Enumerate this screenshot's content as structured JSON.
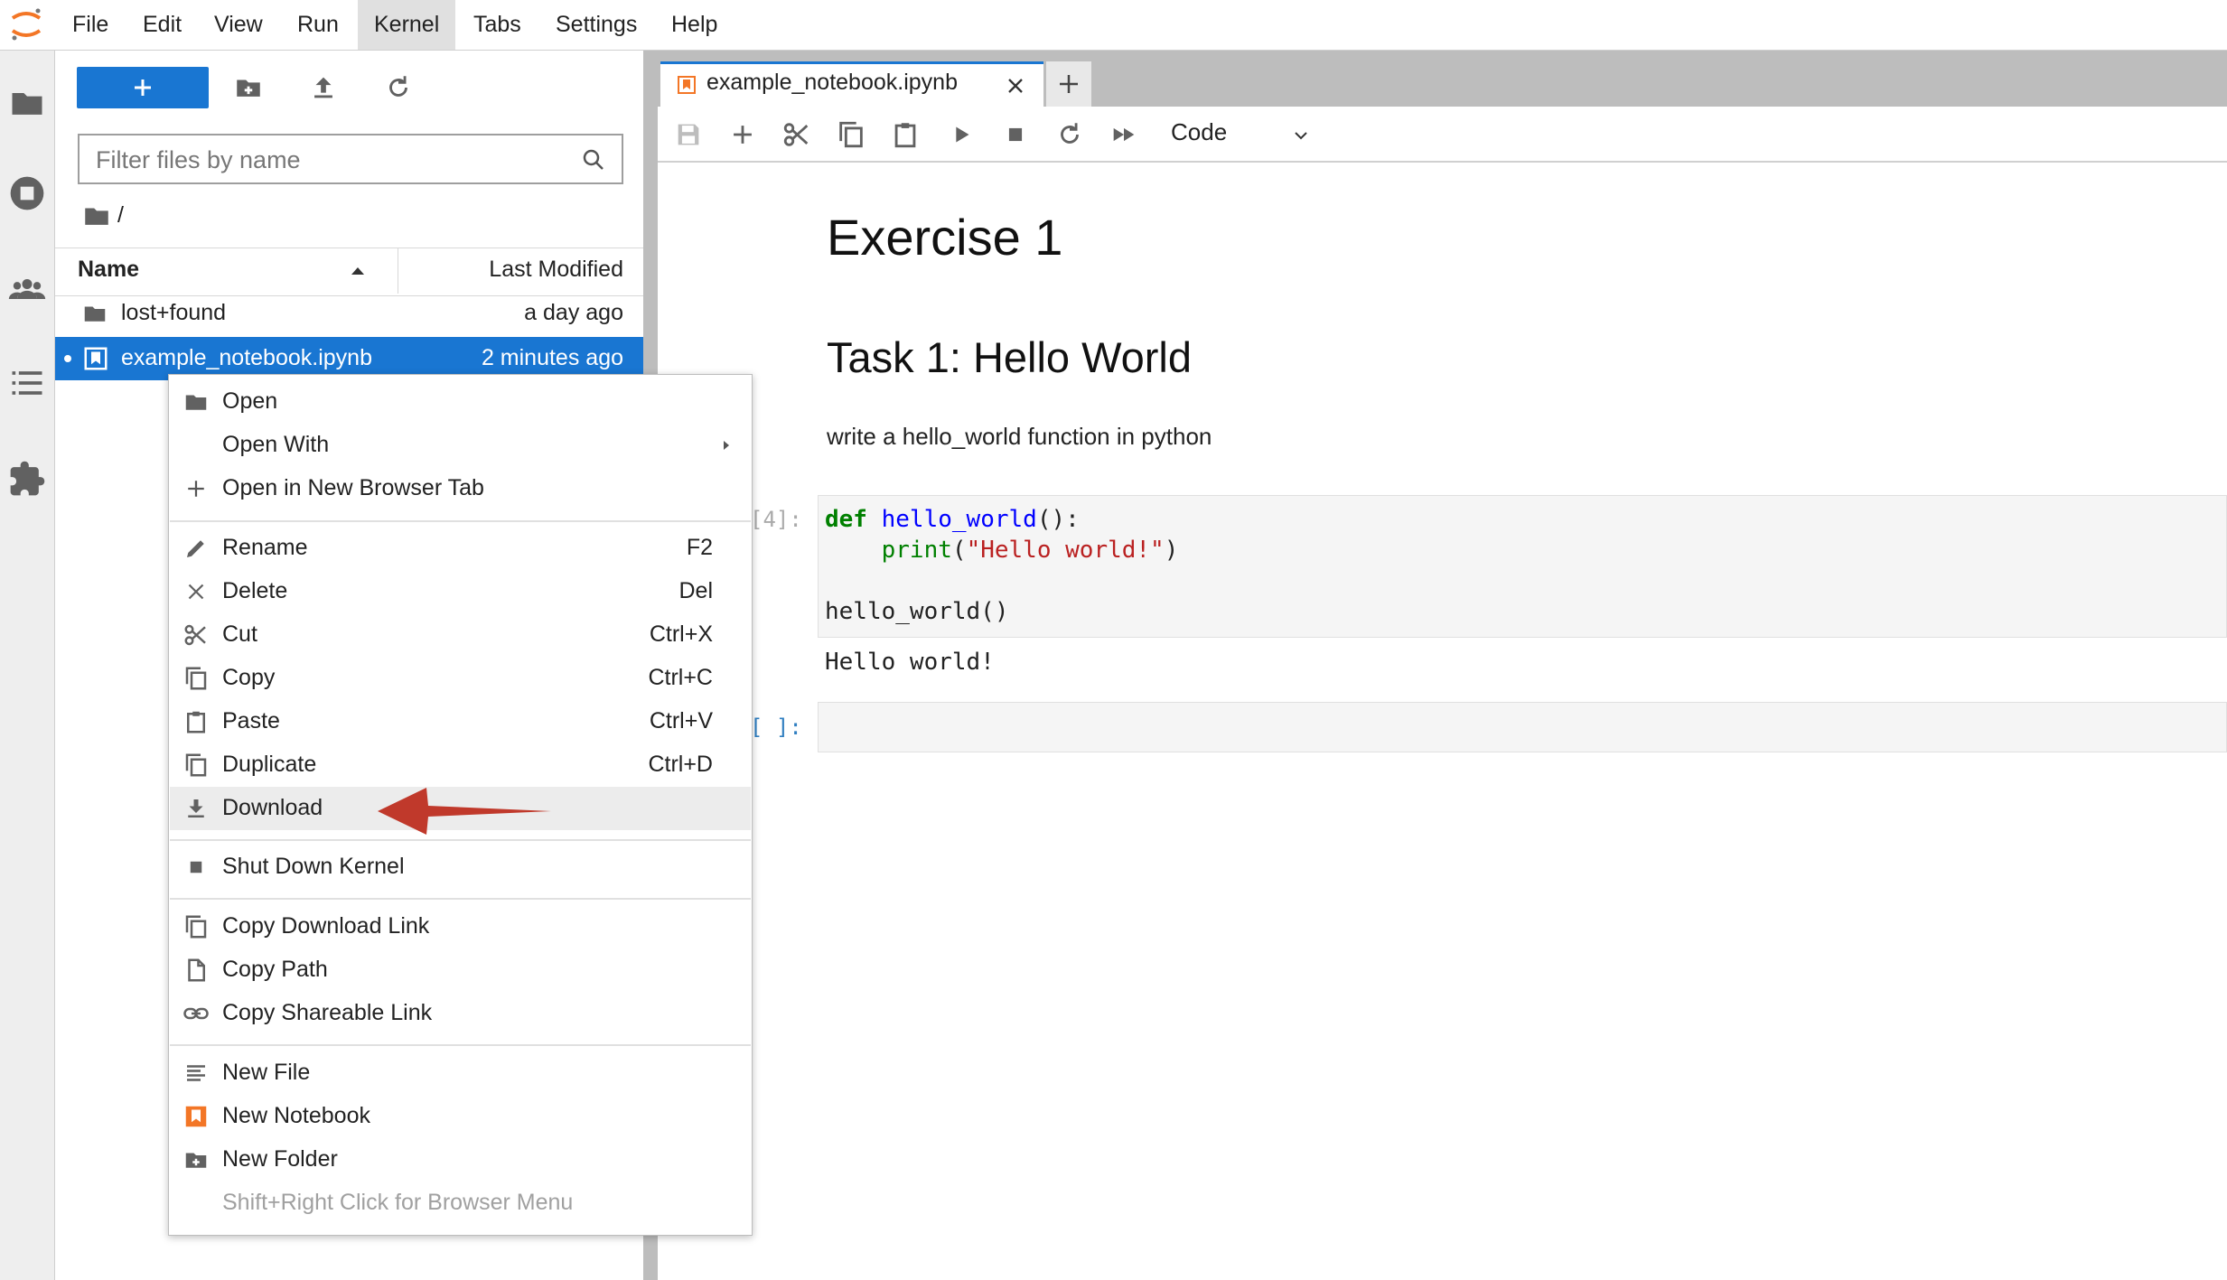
{
  "menubar": {
    "items": [
      "File",
      "Edit",
      "View",
      "Run",
      "Kernel",
      "Tabs",
      "Settings",
      "Help"
    ],
    "active": "Kernel"
  },
  "filebrowser": {
    "filter_placeholder": "Filter files by name",
    "breadcrumb": "/",
    "columns": {
      "name": "Name",
      "modified": "Last Modified"
    },
    "files": [
      {
        "name": "lost+found",
        "modified": "a day ago",
        "type": "folder"
      },
      {
        "name": "example_notebook.ipynb",
        "modified": "2 minutes ago",
        "type": "notebook",
        "selected": true
      }
    ]
  },
  "notebook": {
    "tab_title": "example_notebook.ipynb",
    "cell_type": "Code",
    "heading1": "Exercise 1",
    "heading2": "Task 1: Hello World",
    "paragraph": "write a hello_world function in python",
    "cell1_prompt": "[4]:",
    "cell1_code": {
      "line1_kw": "def",
      "line1_fn": "hello_world",
      "line1_rest": "():",
      "line2_indent": "    ",
      "line2_fn": "print",
      "line2_open": "(",
      "line2_str": "\"Hello world!\"",
      "line2_close": ")",
      "line4": "hello_world()"
    },
    "cell1_output": "Hello world!",
    "cell2_prompt": "[ ]:"
  },
  "context_menu": {
    "items": [
      {
        "label": "Open",
        "shortcut": "",
        "icon": "folder-icon"
      },
      {
        "label": "Open With",
        "shortcut": "",
        "icon": "",
        "submenu": true
      },
      {
        "label": "Open in New Browser Tab",
        "shortcut": "",
        "icon": "plus-icon"
      },
      {
        "label": "Rename",
        "shortcut": "F2",
        "icon": "pencil-icon"
      },
      {
        "label": "Delete",
        "shortcut": "Del",
        "icon": "close-icon"
      },
      {
        "label": "Cut",
        "shortcut": "Ctrl+X",
        "icon": "scissors-icon"
      },
      {
        "label": "Copy",
        "shortcut": "Ctrl+C",
        "icon": "copy-icon"
      },
      {
        "label": "Paste",
        "shortcut": "Ctrl+V",
        "icon": "paste-icon"
      },
      {
        "label": "Duplicate",
        "shortcut": "Ctrl+D",
        "icon": "copy-icon"
      },
      {
        "label": "Download",
        "shortcut": "",
        "icon": "download-icon",
        "hover": true
      },
      {
        "label": "Shut Down Kernel",
        "shortcut": "",
        "icon": "stop-icon"
      },
      {
        "label": "Copy Download Link",
        "shortcut": "",
        "icon": "copy-icon"
      },
      {
        "label": "Copy Path",
        "shortcut": "",
        "icon": "file-icon"
      },
      {
        "label": "Copy Shareable Link",
        "shortcut": "",
        "icon": "link-icon"
      },
      {
        "label": "New File",
        "shortcut": "",
        "icon": "text-file-icon"
      },
      {
        "label": "New Notebook",
        "shortcut": "",
        "icon": "notebook-icon"
      },
      {
        "label": "New Folder",
        "shortcut": "",
        "icon": "new-folder-icon"
      },
      {
        "label": "Shift+Right Click for Browser Menu",
        "shortcut": "",
        "icon": "",
        "disabled": true
      }
    ]
  },
  "colors": {
    "accent": "#1976d2",
    "notebook_orange": "#f37626",
    "annotation_arrow": "#c0392b"
  }
}
